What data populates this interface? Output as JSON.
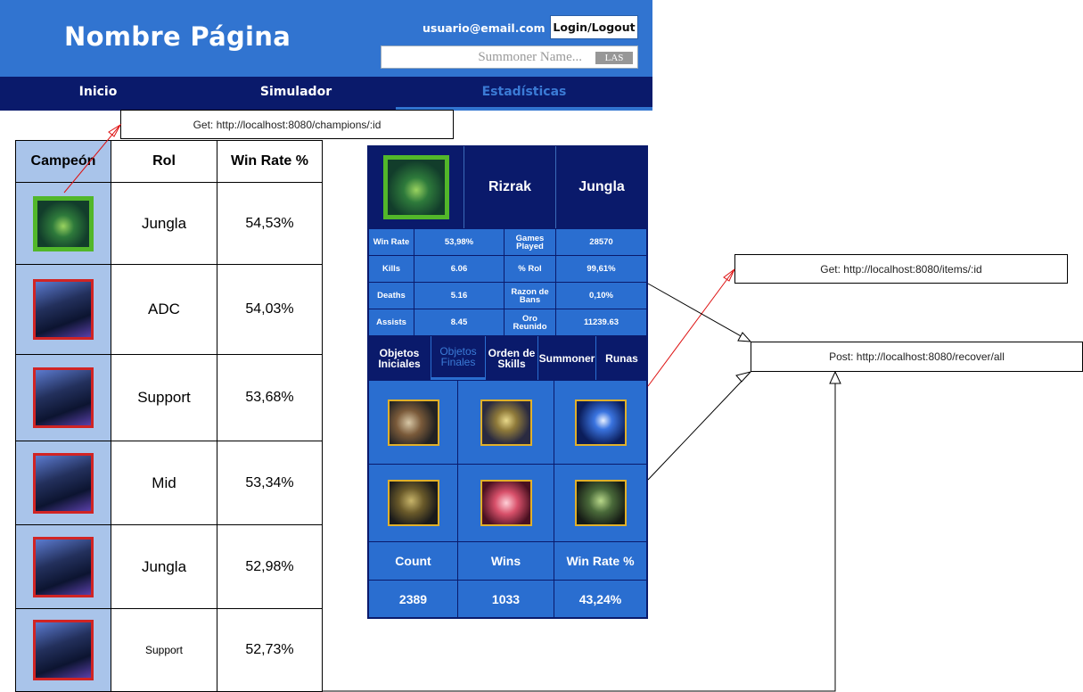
{
  "header": {
    "site_title": "Nombre Página",
    "user_email": "usuario@email.com",
    "login_label": "Login/Logout",
    "search_placeholder": "Summoner Name...",
    "region": "LAS",
    "bg_color": "#3174d0",
    "nav_color": "#0a1a6b"
  },
  "nav": {
    "items": [
      {
        "label": "Inicio"
      },
      {
        "label": "Simulador"
      },
      {
        "label": "Estadísticas",
        "active": true
      }
    ]
  },
  "api_calls": {
    "champions": "Get: http://localhost:8080/champions/:id",
    "items": "Get: http://localhost:8080/items/:id",
    "recover": "Post: http://localhost:8080/recover/all"
  },
  "champion_table": {
    "headers": [
      "Campeón",
      "Rol",
      "Win Rate %"
    ],
    "rows": [
      {
        "role": "Jungla",
        "win_rate": "54,53%",
        "icon": "green-champion-portrait"
      },
      {
        "role": "ADC",
        "win_rate": "54,03%",
        "icon": "dark-champion-portrait"
      },
      {
        "role": "Support",
        "win_rate": "53,68%",
        "icon": "dark-champion-portrait"
      },
      {
        "role": "Mid",
        "win_rate": "53,34%",
        "icon": "dark-champion-portrait"
      },
      {
        "role": "Jungla",
        "win_rate": "52,98%",
        "icon": "dark-champion-portrait"
      },
      {
        "role": "Support",
        "win_rate": "52,73%",
        "icon": "dark-champion-portrait"
      }
    ]
  },
  "champion_detail": {
    "name": "Rizrak",
    "role": "Jungla",
    "stats": [
      {
        "label1": "Win Rate",
        "value1": "53,98%",
        "label2": "Games Played",
        "value2": "28570"
      },
      {
        "label1": "Kills",
        "value1": "6.06",
        "label2": "% Rol",
        "value2": "99,61%"
      },
      {
        "label1": "Deaths",
        "value1": "5.16",
        "label2": "Razon de Bans",
        "value2": "0,10%"
      },
      {
        "label1": "Assists",
        "value1": "8.45",
        "label2": "Oro Reunido",
        "value2": "11239.63"
      }
    ],
    "tabs": [
      {
        "label": "Objetos Iniciales"
      },
      {
        "label": "Objetos Finales",
        "active": true
      },
      {
        "label": "Orden de Skills"
      },
      {
        "label": "Summoner"
      },
      {
        "label": "Runas"
      }
    ],
    "items": [
      {
        "icon": "boots-item-icon"
      },
      {
        "icon": "amulet-item-icon"
      },
      {
        "icon": "orb-item-icon"
      },
      {
        "icon": "claw-item-icon"
      },
      {
        "icon": "gem-item-icon"
      },
      {
        "icon": "armor-item-icon"
      }
    ],
    "footer_headers": [
      "Count",
      "Wins",
      "Win Rate %"
    ],
    "footer_values": [
      "2389",
      "1033",
      "43,24%"
    ]
  }
}
